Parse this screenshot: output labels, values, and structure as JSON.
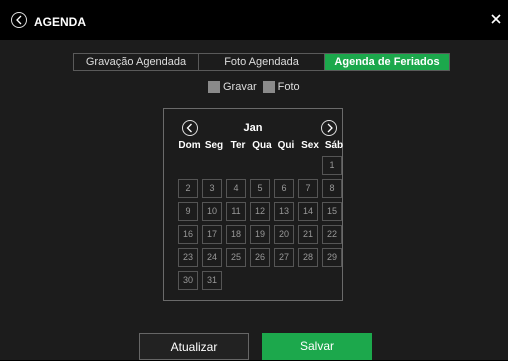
{
  "header": {
    "title": "AGENDA"
  },
  "tabs": [
    {
      "label": "Gravação Agendada"
    },
    {
      "label": "Foto Agendada"
    },
    {
      "label": "Agenda de Feriados"
    }
  ],
  "legend": {
    "record_label": "Gravar",
    "photo_label": "Foto"
  },
  "calendar": {
    "month": "Jan",
    "weekdays": [
      "Dom",
      "Seg",
      "Ter",
      "Qua",
      "Qui",
      "Sex",
      "Sáb"
    ],
    "days": [
      "1",
      "2",
      "3",
      "4",
      "5",
      "6",
      "7",
      "8",
      "9",
      "10",
      "11",
      "12",
      "13",
      "14",
      "15",
      "16",
      "17",
      "18",
      "19",
      "20",
      "21",
      "22",
      "23",
      "24",
      "25",
      "26",
      "27",
      "28",
      "29",
      "30",
      "31"
    ]
  },
  "buttons": {
    "update_label": "Atualizar",
    "save_label": "Salvar"
  },
  "colors": {
    "accent": "#1ca84c",
    "background": "#1c1c1c",
    "titlebar": "#000000"
  }
}
